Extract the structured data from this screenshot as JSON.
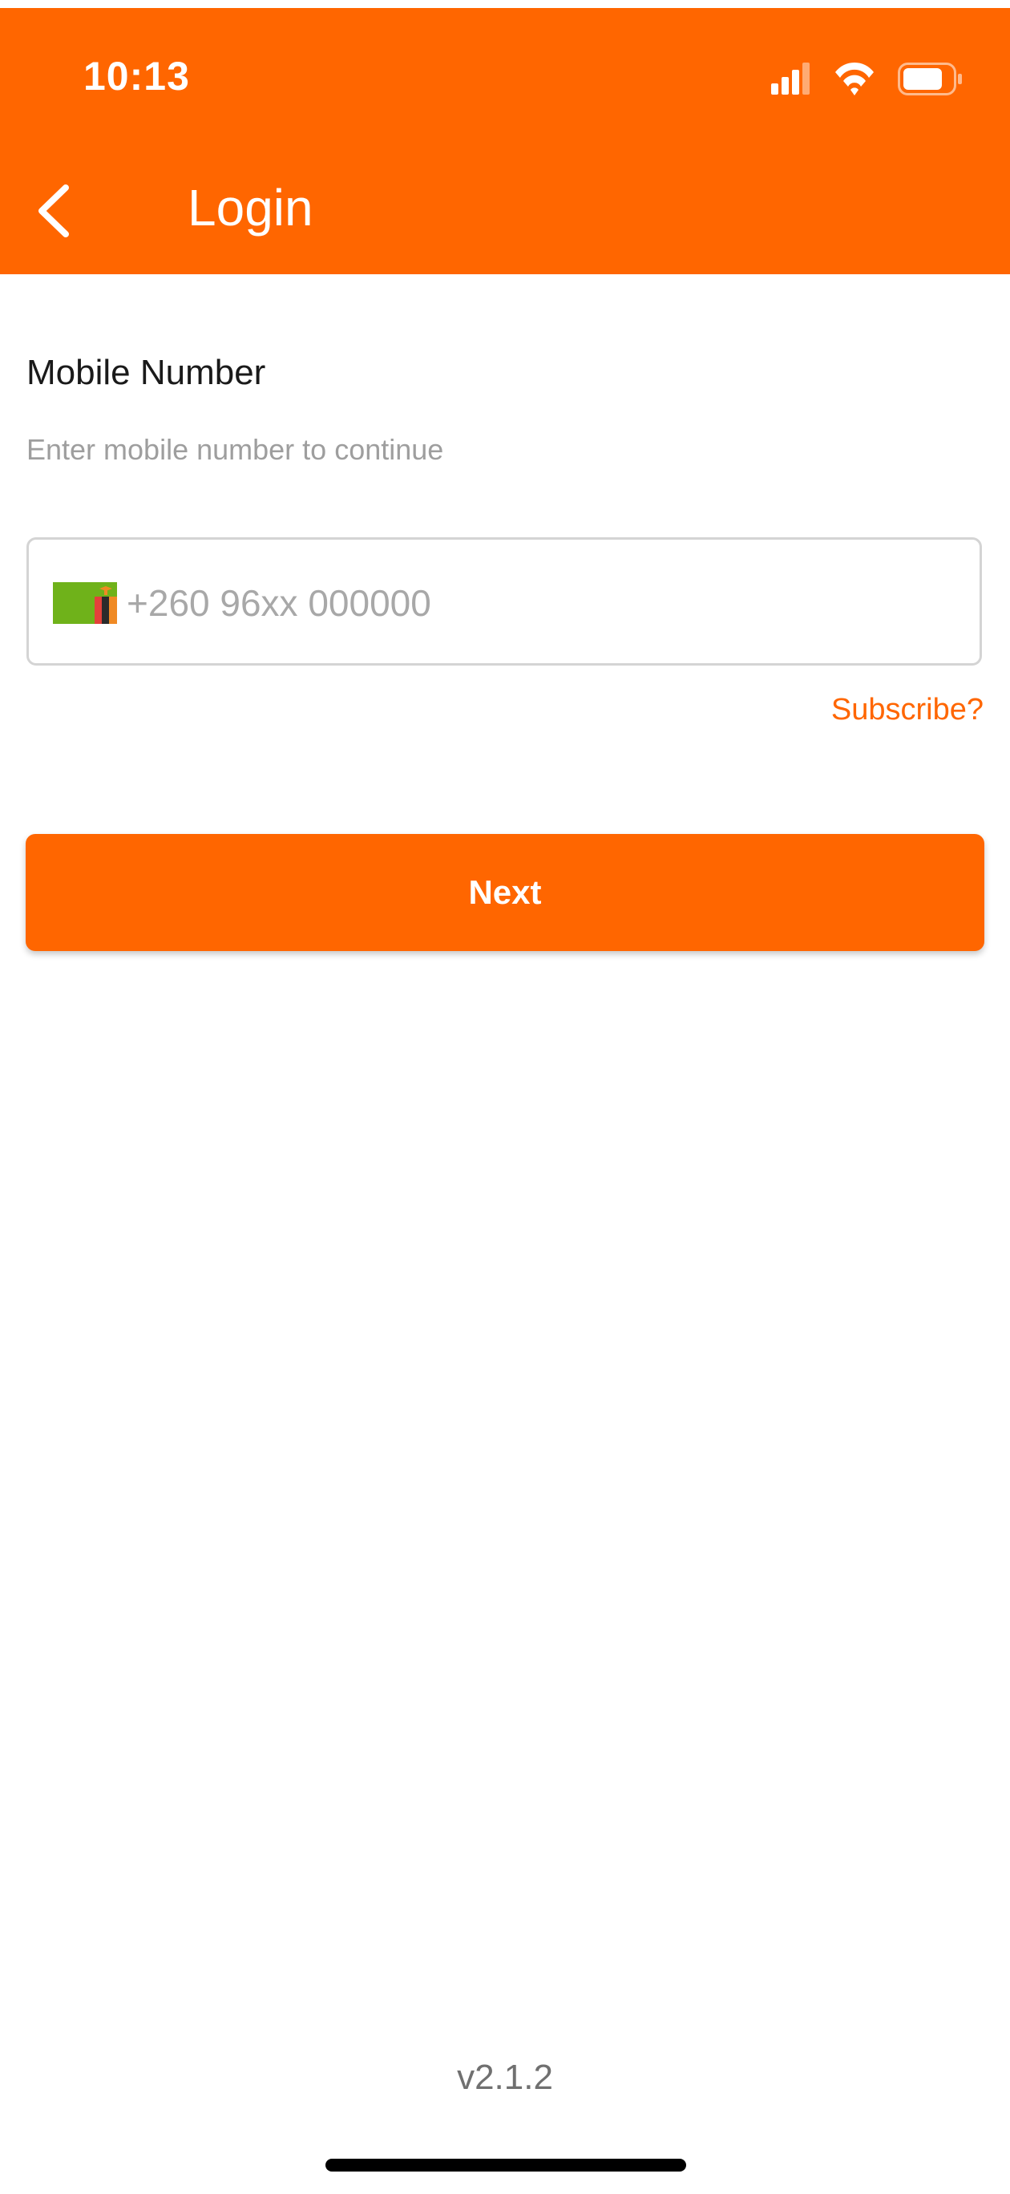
{
  "status_bar": {
    "time": "10:13",
    "icons": [
      "signal-icon",
      "wifi-icon",
      "battery-icon"
    ]
  },
  "header": {
    "title": "Login",
    "back_icon": "chevron-left-icon"
  },
  "form": {
    "title": "Mobile Number",
    "subtitle": "Enter mobile number to continue",
    "phone_value": "",
    "phone_placeholder": "+260 96xx 000000",
    "country_flag": "zambia-flag-icon",
    "subscribe_link": "Subscribe?",
    "next_button": "Next"
  },
  "footer": {
    "version": "v2.1.2"
  },
  "colors": {
    "brand": "#FF6600",
    "background": "#FFFFFF",
    "muted_text": "#9E9E9E"
  }
}
